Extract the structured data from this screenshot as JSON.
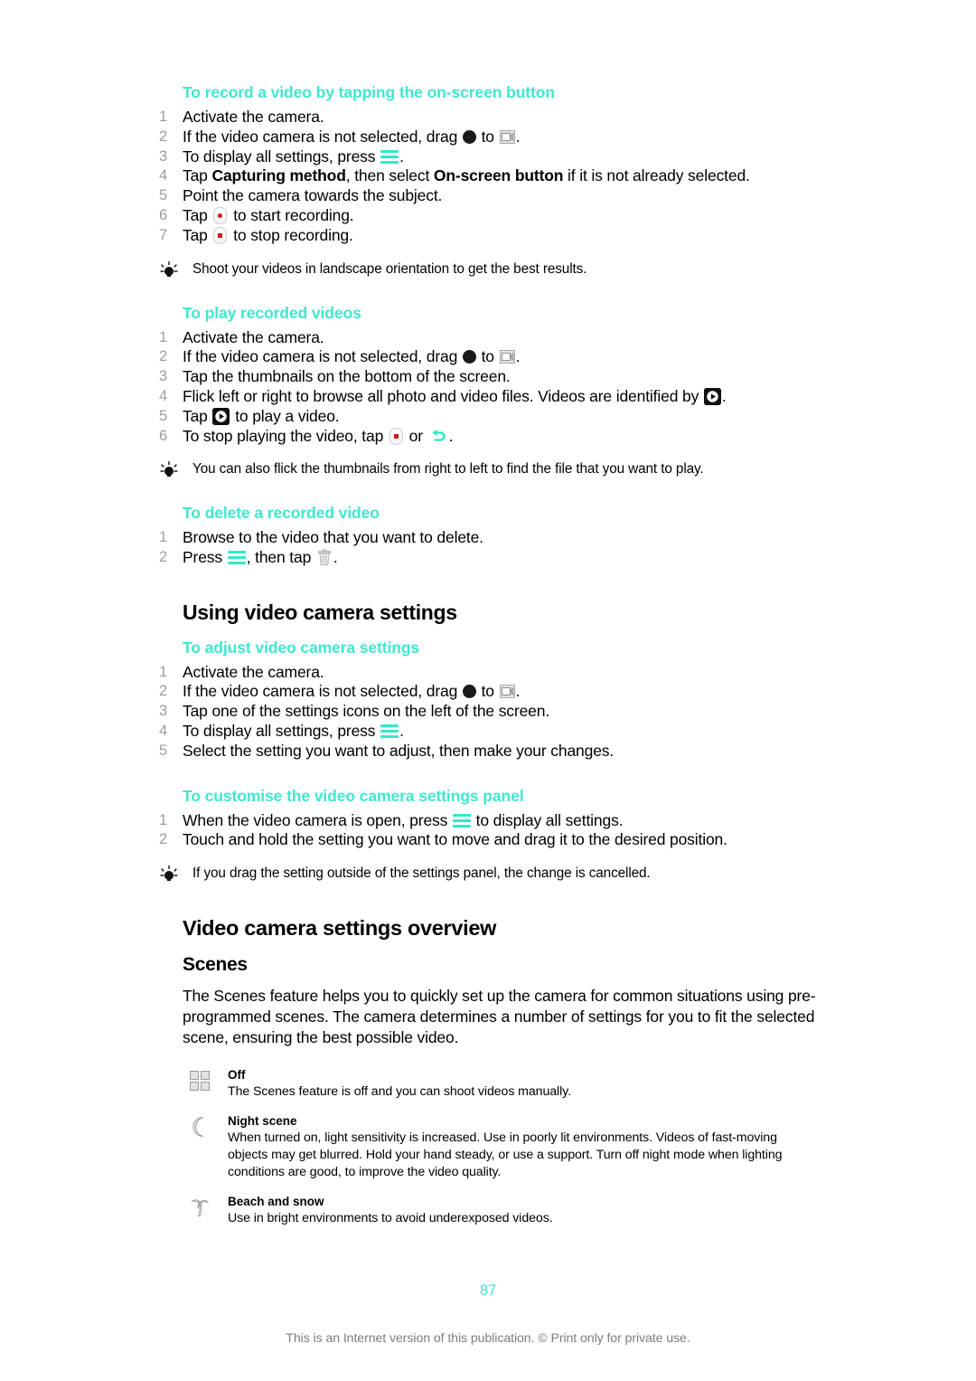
{
  "page": {
    "number": "87",
    "footer_note": "This is an Internet version of this publication. © Print only for private use.",
    "accent_color": "#3fe8cd",
    "step_number_color": "#9d9d9d"
  },
  "procedures": [
    {
      "id": "record-on-screen-button",
      "title": "To record a video by tapping the on-screen button",
      "steps": [
        {
          "pre": "Activate the camera."
        },
        {
          "pre": "If the video camera is not selected, drag ",
          "icon1": "black-circle-icon",
          "mid": " to ",
          "icon2": "video-camera-icon",
          "post": "."
        },
        {
          "pre": "To display all settings, press ",
          "icon1": "menu-key-icon",
          "post": "."
        },
        {
          "pre": "Tap ",
          "bold1": "Capturing method",
          "mid": ", then select ",
          "bold2": "On-screen button",
          "post": " if it is not already selected."
        },
        {
          "pre": "Point the camera towards the subject."
        },
        {
          "pre": "Tap ",
          "icon1": "record-start-icon",
          "post": " to start recording."
        },
        {
          "pre": "Tap ",
          "icon1": "record-stop-icon",
          "post": " to stop recording."
        }
      ],
      "tip": "Shoot your videos in landscape orientation to get the best results."
    },
    {
      "id": "play-recorded-videos",
      "title": "To play recorded videos",
      "steps": [
        {
          "pre": "Activate the camera."
        },
        {
          "pre": "If the video camera is not selected, drag ",
          "icon1": "black-circle-icon",
          "mid": " to ",
          "icon2": "video-camera-icon",
          "post": "."
        },
        {
          "pre": "Tap the thumbnails on the bottom of the screen."
        },
        {
          "pre": "Flick left or right to browse all photo and video files. Videos are identified by ",
          "icon1": "play-badge-icon",
          "post": "."
        },
        {
          "pre": "Tap ",
          "icon1": "play-badge-icon",
          "post": " to play a video."
        },
        {
          "pre": "To stop playing the video, tap ",
          "icon1": "record-stop-icon",
          "mid": " or ",
          "icon2": "back-arrow-icon",
          "post": "."
        }
      ],
      "tip": "You can also flick the thumbnails from right to left to find the file that you want to play."
    },
    {
      "id": "delete-recorded-video",
      "title": "To delete a recorded video",
      "steps": [
        {
          "pre": "Browse to the video that you want to delete."
        },
        {
          "pre": "Press ",
          "icon1": "menu-key-icon",
          "mid": ", then tap ",
          "icon2": "trash-icon",
          "post": "."
        }
      ],
      "tip": null
    }
  ],
  "section_using": {
    "heading": "Using video camera settings",
    "procedures": [
      {
        "id": "adjust-video-camera-settings",
        "title": "To adjust video camera settings",
        "steps": [
          {
            "pre": "Activate the camera."
          },
          {
            "pre": "If the video camera is not selected, drag ",
            "icon1": "black-circle-icon",
            "mid": " to ",
            "icon2": "video-camera-icon",
            "post": "."
          },
          {
            "pre": "Tap one of the settings icons on the left of the screen."
          },
          {
            "pre": "To display all settings, press ",
            "icon1": "menu-key-icon",
            "post": "."
          },
          {
            "pre": "Select the setting you want to adjust, then make your changes."
          }
        ],
        "tip": null
      },
      {
        "id": "customise-settings-panel",
        "title": "To customise the video camera settings panel",
        "steps": [
          {
            "pre": "When the video camera is open, press ",
            "icon1": "menu-key-icon",
            "post": " to display all settings."
          },
          {
            "pre": "Touch and hold the setting you want to move and drag it to the desired position."
          }
        ],
        "tip": "If you drag the setting outside of the settings panel, the change is cancelled."
      }
    ]
  },
  "section_overview": {
    "heading": "Video camera settings overview",
    "subsection": {
      "heading": "Scenes",
      "intro": "The Scenes feature helps you to quickly set up the camera for common situations using pre-programmed scenes. The camera determines a number of settings for you to fit the selected scene, ensuring the best possible video.",
      "scenes": [
        {
          "icon": "grid-off-icon",
          "name": "Off",
          "description": "The Scenes feature is off and you can shoot videos manually."
        },
        {
          "icon": "crescent-moon-icon",
          "name": "Night scene",
          "description": "When turned on, light sensitivity is increased. Use in poorly lit environments. Videos of fast-moving objects may get blurred. Hold your hand steady, or use a support. Turn off night mode when lighting conditions are good, to improve the video quality."
        },
        {
          "icon": "palm-tree-icon",
          "name": "Beach and snow",
          "description": "Use in bright environments to avoid underexposed videos."
        }
      ]
    }
  }
}
